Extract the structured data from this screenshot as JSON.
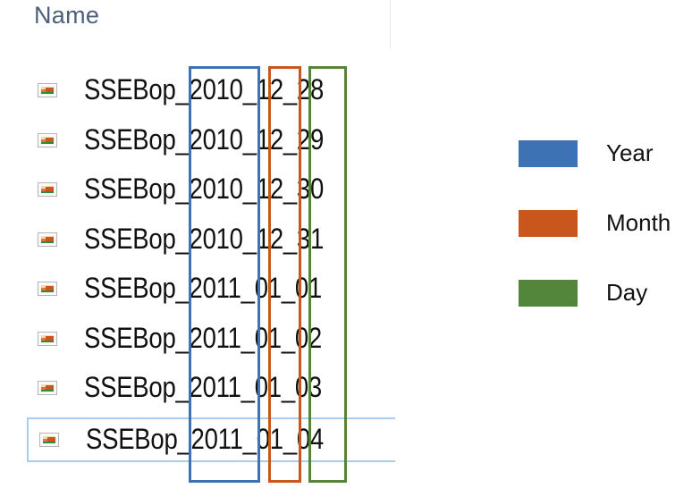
{
  "header": {
    "title": "Name"
  },
  "files": [
    {
      "name": "SSEBop_2010_12_28",
      "selected": false
    },
    {
      "name": "SSEBop_2010_12_29",
      "selected": false
    },
    {
      "name": "SSEBop_2010_12_30",
      "selected": false
    },
    {
      "name": "SSEBop_2010_12_31",
      "selected": false
    },
    {
      "name": "SSEBop_2011_01_01",
      "selected": false
    },
    {
      "name": "SSEBop_2011_01_02",
      "selected": false
    },
    {
      "name": "SSEBop_2011_01_03",
      "selected": false
    },
    {
      "name": "SSEBop_2011_01_04",
      "selected": true
    }
  ],
  "legend": [
    {
      "label": "Year",
      "color": "#3d72b4"
    },
    {
      "label": "Month",
      "color": "#c9561c"
    },
    {
      "label": "Day",
      "color": "#53853b"
    }
  ],
  "icons": {
    "file": "image-file-icon"
  }
}
